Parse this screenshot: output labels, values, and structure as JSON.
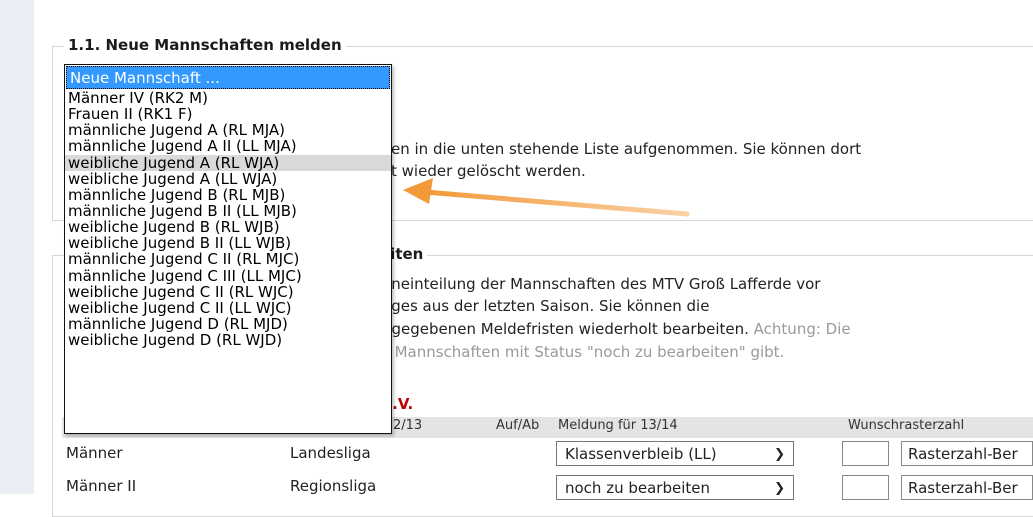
{
  "section1": {
    "title": "1.1. Neue Mannschaften melden",
    "text_line1": "en in die unten stehende Liste aufgenommen. Sie können dort",
    "text_line2": "t wieder gelöscht werden."
  },
  "dropdown": {
    "options": [
      "Neue Mannschaft ...",
      "Männer IV (RK2 M)",
      "Frauen II (RK1 F)",
      "männliche Jugend A (RL MJA)",
      "männliche Jugend A II (LL MJA)",
      "weibliche Jugend A (RL WJA)",
      "weibliche Jugend A (LL WJA)",
      "männliche Jugend B (RL MJB)",
      "männliche Jugend B II (LL MJB)",
      "weibliche Jugend B (RL WJB)",
      "weibliche Jugend B II (LL WJB)",
      "männliche Jugend C II (RL MJC)",
      "männliche Jugend C III (LL MJC)",
      "weibliche Jugend C II (RL WJC)",
      "weibliche Jugend C II (LL WJC)",
      "männliche Jugend D (RL MJD)",
      "weibliche Jugend D (RL WJD)"
    ],
    "selected_index": 0,
    "hover_index": 5
  },
  "section2": {
    "title_partial": "eiten",
    "line1": "eneinteilung der Mannschaften des MTV Groß Lafferde vor",
    "line2": "eges aus der letzten Saison. Sie können die",
    "line3_main": "ngegebenen Meldefristen wiederholt bearbeiten.",
    "line3_grey": " Achtung: Die",
    "line4": "s Mannschaften mit Status \"noch zu bearbeiten\" gibt.",
    "club_partial": "e.V."
  },
  "table": {
    "headers": {
      "season_partial": "2/13",
      "aufab": "Auf/Ab",
      "meldung": "Meldung für 13/14",
      "wunsch": "Wunschrasterzahl"
    },
    "rows": [
      {
        "team": "Männer",
        "league": "Landesliga",
        "meldung": "Klassenverbleib (LL)",
        "raster": "Rasterzahl-Ber"
      },
      {
        "team": "Männer II",
        "league": "Regionsliga",
        "meldung": "noch zu bearbeiten",
        "raster": "Rasterzahl-Ber"
      }
    ]
  },
  "colors": {
    "accent_arrow": "#f29a38",
    "selected_option": "#3399ff",
    "club_name_red": "#c00000"
  }
}
